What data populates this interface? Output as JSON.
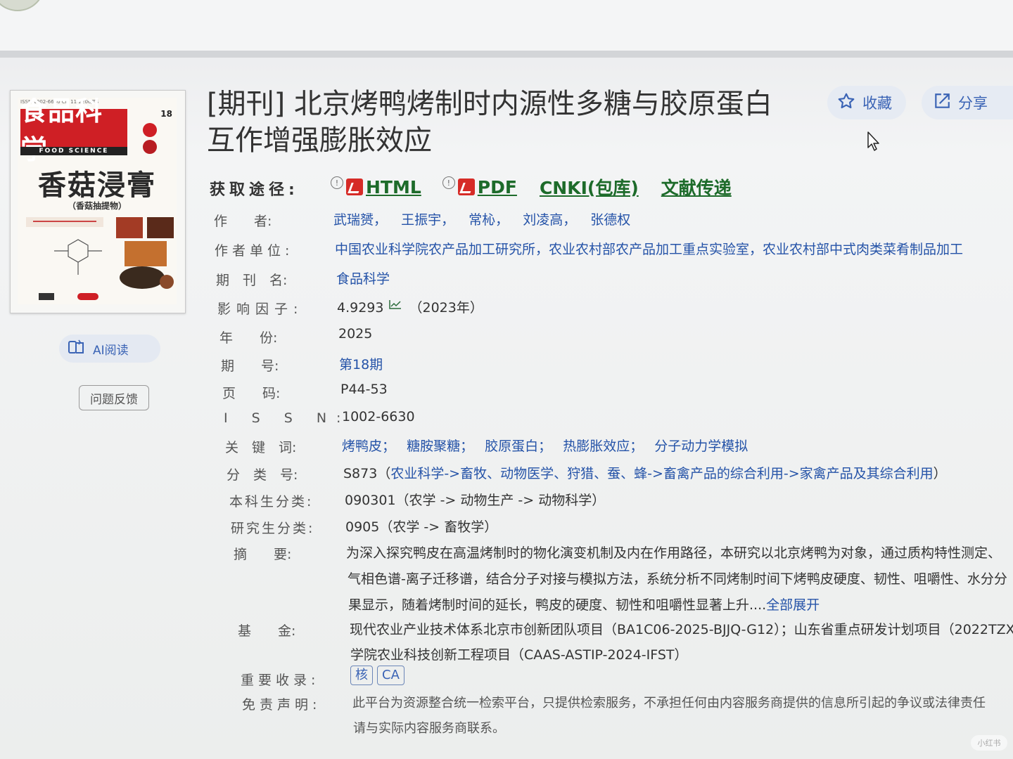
{
  "cover": {
    "journal_cn": "食品科学",
    "journal_en": "FOOD SCIENCE",
    "feature": "香菇浸膏",
    "feature_sub": "（香菇抽提物）",
    "issue_no": "18"
  },
  "sidebar": {
    "ai_read": "AI阅读",
    "feedback": "问题反馈"
  },
  "article": {
    "title": "[期刊] 北京烤鸭烤制时内源性多糖与胶原蛋白互作增强膨胀效应"
  },
  "actions": {
    "favorite": "收藏",
    "share": "分享"
  },
  "access": {
    "label": "获取途径:",
    "html": "HTML",
    "pdf": "PDF",
    "cnki": "CNKI(包库)",
    "delivery": "文献传递"
  },
  "fields": {
    "authors_label": "作　　者:",
    "authors": [
      "武瑞赟，",
      "王振宇，",
      "常杺，",
      "刘凌高，",
      "张德权"
    ],
    "affil_label": "作者单位:",
    "affiliation": "中国农业科学院农产品加工研究所，农业农村部农产品加工重点实验室，农业农村部中式肉类菜肴制品加工",
    "journal_label": "期　刊　名:",
    "journal": "食品科学",
    "if_label": "影响因子:",
    "impact_factor": "4.9293",
    "if_year": "（2023年）",
    "year_label": "年　　份:",
    "year": "2025",
    "issue_label": "期　　号:",
    "issue": "第18期",
    "pages_label": "页　　码:",
    "pages": "P44-53",
    "issn_label": "I S S N:",
    "issn": "1002-6630",
    "keywords_label": "关　键　词:",
    "keywords": [
      "烤鸭皮；",
      "糖胺聚糖；",
      "胶原蛋白；",
      "热膨胀效应；",
      "分子动力学模拟"
    ],
    "class_label": "分　类　号:",
    "class_code": "S873（",
    "class_path": "农业科学->畜牧、动物医学、狩猎、蚕、蜂->畜禽产品的综合利用->家禽产品及其综合利用",
    "class_end": "）",
    "ug_label": "本科生分类:",
    "ug_class": "090301（农学 -> 动物生产 -> 动物科学）",
    "pg_label": "研究生分类:",
    "pg_class": "0905（农学 -> 畜牧学）",
    "abstract_label": "摘　　要:",
    "abstract_1": "为深入探究鸭皮在高温烤制时的物化演变机制及内在作用路径，本研究以北京烤鸭为对象，通过质构特性测定、",
    "abstract_2": "气相色谱-离子迁移谱，结合分子对接与模拟方法，系统分析不同烤制时间下烤鸭皮硬度、韧性、咀嚼性、水分分",
    "abstract_3": "果显示，随着烤制时间的延长，鸭皮的硬度、韧性和咀嚼性显著上升....",
    "expand": "全部展开",
    "fund_label": "基　　金:",
    "fund_1": "现代农业产业技术体系北京市创新团队项目（BA1C06-2025-BJJQ-G12）；山东省重点研发计划项目（2022TZX",
    "fund_2": "学院农业科技创新工程项目（CAAS-ASTIP-2024-IFST）",
    "index_label": "重要收录:",
    "index_badges": [
      "核",
      "CA"
    ],
    "disclaimer_label": "免责声明:",
    "disclaimer_1": "此平台为资源整合统一检索平台，只提供检索服务，不承担任何由内容服务商提供的信息所引起的争议或法律责任",
    "disclaimer_2": "请与实际内容服务商联系。"
  },
  "watermark": "小红书",
  "colors": {
    "link_blue": "#2553a8",
    "access_green": "#1d6b2a",
    "accent_red": "#cf1f25"
  }
}
